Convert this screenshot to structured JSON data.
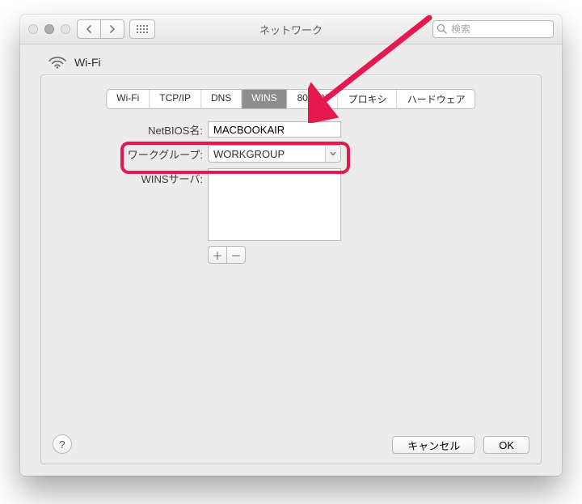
{
  "window": {
    "title": "ネットワーク",
    "search_placeholder": "検索"
  },
  "header": {
    "interface": "Wi-Fi"
  },
  "tabs": [
    {
      "label": "Wi-Fi",
      "active": false
    },
    {
      "label": "TCP/IP",
      "active": false
    },
    {
      "label": "DNS",
      "active": false
    },
    {
      "label": "WINS",
      "active": true
    },
    {
      "label": "802.1X",
      "active": false
    },
    {
      "label": "プロキシ",
      "active": false
    },
    {
      "label": "ハードウェア",
      "active": false
    }
  ],
  "form": {
    "netbios_label": "NetBIOS名:",
    "netbios_value": "MACBOOKAIR",
    "workgroup_label": "ワークグループ:",
    "workgroup_value": "WORKGROUP",
    "wins_label": "WINSサーバ:",
    "wins_servers": []
  },
  "buttons": {
    "add": "＋",
    "remove": "－",
    "cancel": "キャンセル",
    "ok": "OK",
    "help": "?"
  },
  "annotation": {
    "arrow_color": "#e5194f",
    "highlight_target": "workgroup-row"
  }
}
